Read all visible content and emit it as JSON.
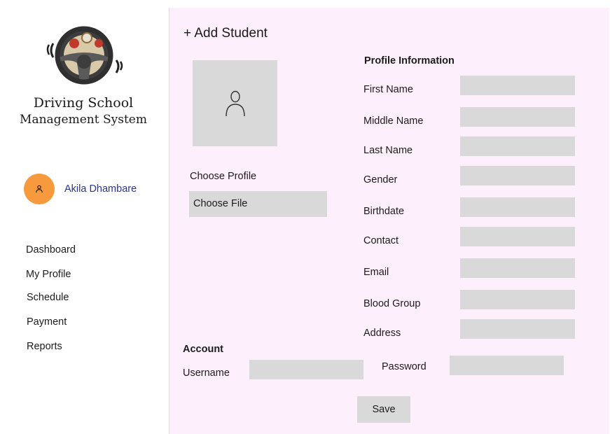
{
  "sidebar": {
    "brand_line1": "Driving School",
    "brand_line2": "Management System",
    "user_name": "Akila Dhambare",
    "nav": [
      "Dashboard",
      "My Profile",
      "Schedule",
      "Payment",
      "Reports"
    ]
  },
  "main": {
    "title": "+ Add Student",
    "choose_profile_label": "Choose Profile",
    "choose_file_label": "Choose File",
    "profile_heading": "Profile Information",
    "profile_fields": [
      {
        "label": "First Name",
        "value": ""
      },
      {
        "label": "Middle Name",
        "value": ""
      },
      {
        "label": "Last Name",
        "value": ""
      },
      {
        "label": "Gender",
        "value": ""
      },
      {
        "label": "Birthdate",
        "value": ""
      },
      {
        "label": "Contact",
        "value": ""
      },
      {
        "label": "Email",
        "value": ""
      },
      {
        "label": "Blood Group",
        "value": ""
      },
      {
        "label": "Address",
        "value": ""
      }
    ],
    "account_heading": "Account",
    "username_label": "Username",
    "password_label": "Password",
    "save_label": "Save"
  },
  "colors": {
    "main_bg": "#fdeffb",
    "field_bg": "#d9d9d9",
    "avatar_bg": "#f79a3e",
    "username_text": "#283593"
  },
  "icons": [
    "steering-wheel-logo",
    "user-icon",
    "avatar-user-icon"
  ]
}
